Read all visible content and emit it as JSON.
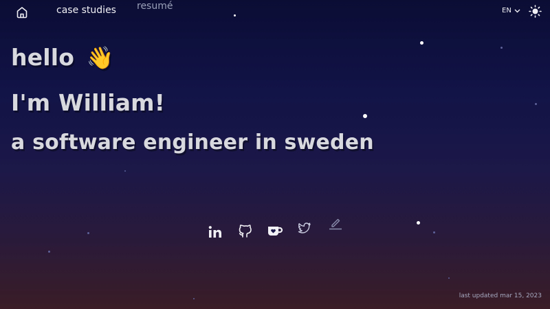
{
  "nav": {
    "home_icon": "home-icon",
    "links": [
      "case studies",
      "resumé"
    ],
    "language": "EN",
    "language_icon": "chevron-down-icon",
    "theme_icon": "sun-icon"
  },
  "hero": {
    "greeting": "hello",
    "wave": "👋",
    "name_line": "I'm William!",
    "role_line": "a software engineer in sweden"
  },
  "socials": [
    "linkedin-icon",
    "github-icon",
    "kofi-icon",
    "twitter-icon",
    "pen-icon"
  ],
  "footer": {
    "last_updated": "last updated mar 15, 2023"
  }
}
